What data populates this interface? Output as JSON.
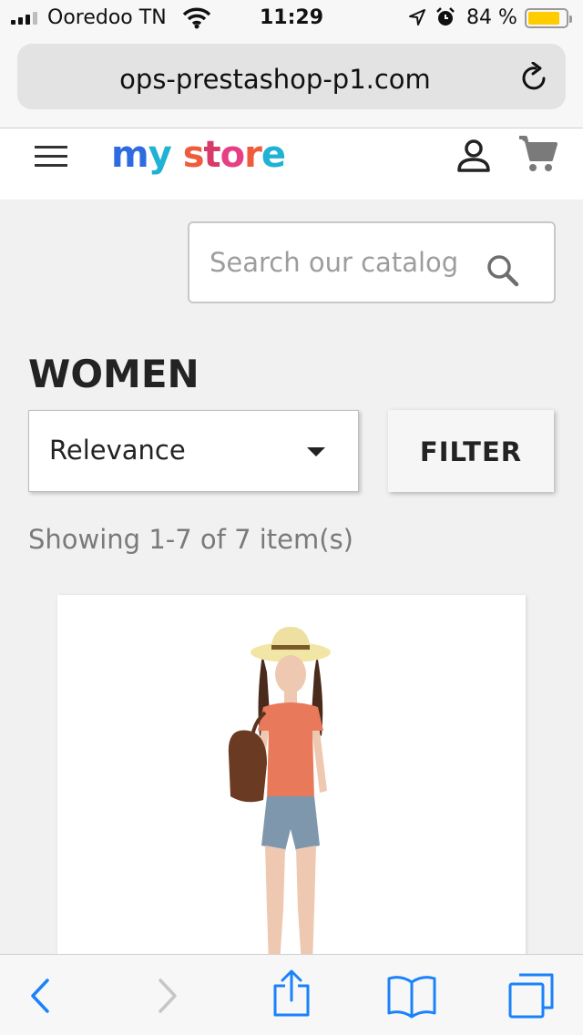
{
  "status_bar": {
    "carrier": "Ooredoo TN",
    "time": "11:29",
    "battery_percent": "84 %",
    "battery_level": 0.84,
    "icons": [
      "signal-icon",
      "wifi-icon",
      "location-icon",
      "alarm-icon",
      "battery-icon"
    ]
  },
  "browser": {
    "url": "ops-prestashop-p1.com",
    "icons": [
      "reload-icon",
      "back-icon",
      "forward-icon",
      "share-icon",
      "bookmarks-icon",
      "tabs-icon"
    ]
  },
  "header": {
    "logo": "my store",
    "icons": [
      "menu-icon",
      "user-icon",
      "cart-icon"
    ]
  },
  "search": {
    "placeholder": "Search our catalog"
  },
  "category": {
    "title": "WOMEN"
  },
  "sort": {
    "selected": "Relevance"
  },
  "filter": {
    "label": "FILTER"
  },
  "results": {
    "summary": "Showing 1-7 of 7 item(s)"
  },
  "colors": {
    "page_background": "#f1f1f1",
    "battery": "#ffcc00",
    "toolbar_icon": "#1a82fb"
  }
}
